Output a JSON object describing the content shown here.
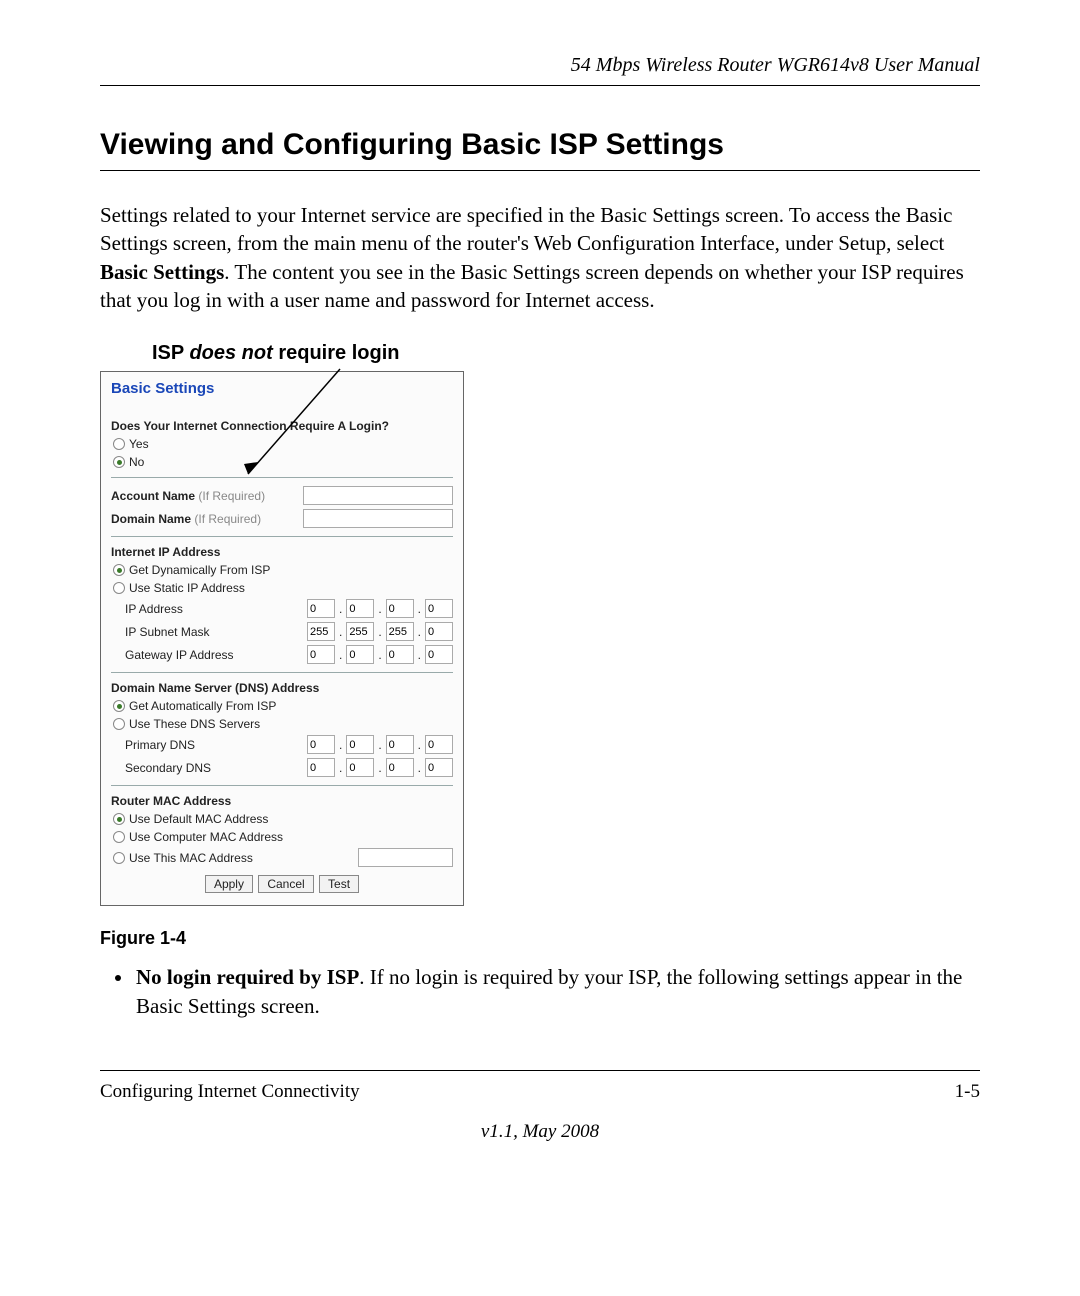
{
  "header": {
    "running_head": "54 Mbps Wireless Router WGR614v8 User Manual"
  },
  "section": {
    "title": "Viewing and Configuring Basic ISP Settings"
  },
  "intro": {
    "p1a": "Settings related to your Internet service are specified in the Basic Settings screen. To access the Basic Settings screen, from the main menu of the router's Web Configuration Interface, under Setup, select ",
    "p1_bold": "Basic Settings",
    "p1b": ". The content you see in the Basic Settings screen depends on whether your ISP requires that you log in with a user name and password for Internet access."
  },
  "callout": {
    "prefix": "ISP ",
    "emph": "does not",
    "suffix": " require login"
  },
  "figure": {
    "caption": "Figure 1-4"
  },
  "shot": {
    "title": "Basic Settings",
    "login": {
      "question": "Does Your Internet Connection Require A Login?",
      "yes": "Yes",
      "no": "No",
      "selected": "no"
    },
    "account": {
      "account_name_label": "Account Name",
      "account_name_note": "(If Required)",
      "account_name_value": "",
      "domain_name_label": "Domain Name",
      "domain_name_note": "(If Required)",
      "domain_name_value": ""
    },
    "ip": {
      "heading": "Internet IP Address",
      "opt_dynamic": "Get Dynamically From ISP",
      "opt_static": "Use Static IP Address",
      "selected": "dynamic",
      "rows": [
        {
          "label": "IP Address",
          "o1": "0",
          "o2": "0",
          "o3": "0",
          "o4": "0"
        },
        {
          "label": "IP Subnet Mask",
          "o1": "255",
          "o2": "255",
          "o3": "255",
          "o4": "0"
        },
        {
          "label": "Gateway IP Address",
          "o1": "0",
          "o2": "0",
          "o3": "0",
          "o4": "0"
        }
      ]
    },
    "dns": {
      "heading": "Domain Name Server (DNS) Address",
      "opt_auto": "Get Automatically From ISP",
      "opt_custom": "Use These DNS Servers",
      "selected": "auto",
      "rows": [
        {
          "label": "Primary DNS",
          "o1": "0",
          "o2": "0",
          "o3": "0",
          "o4": "0"
        },
        {
          "label": "Secondary DNS",
          "o1": "0",
          "o2": "0",
          "o3": "0",
          "o4": "0"
        }
      ]
    },
    "mac": {
      "heading": "Router MAC Address",
      "opt_default": "Use Default MAC Address",
      "opt_computer": "Use Computer MAC Address",
      "opt_this": "Use This MAC Address",
      "selected": "default",
      "this_value": ""
    },
    "buttons": {
      "apply": "Apply",
      "cancel": "Cancel",
      "test": "Test"
    }
  },
  "bullet": {
    "lead_bold": "No login required by ISP",
    "rest": ". If no login is required by your ISP, the following settings appear in the Basic Settings screen."
  },
  "footer": {
    "left": "Configuring Internet Connectivity",
    "right": "1-5",
    "version": "v1.1, May 2008"
  }
}
